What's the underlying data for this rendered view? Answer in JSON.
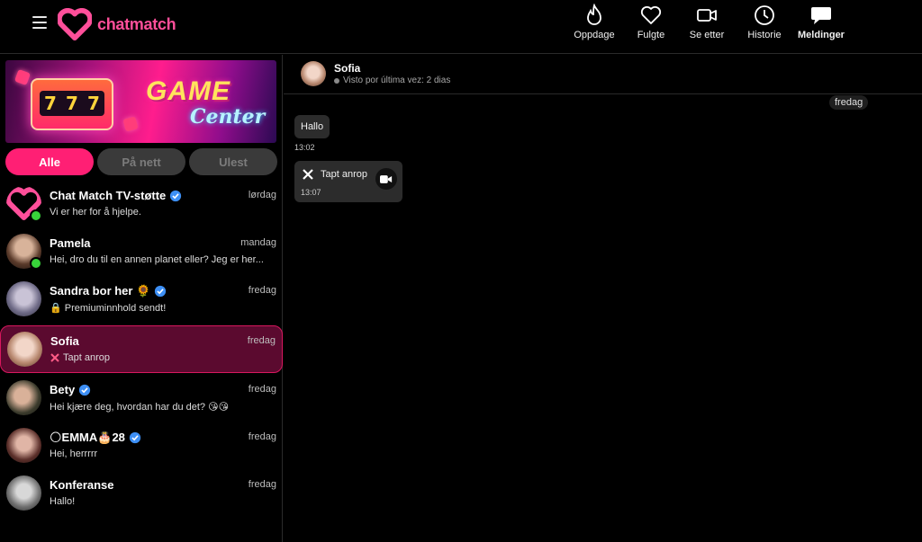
{
  "app": {
    "brand": "chatmatch",
    "brand_color": "#ff4f9a"
  },
  "nav": {
    "items": [
      {
        "label": "Oppdage",
        "icon": "flame-icon"
      },
      {
        "label": "Fulgte",
        "icon": "heart-icon"
      },
      {
        "label": "Se etter",
        "icon": "video-camera-icon"
      },
      {
        "label": "Historie",
        "icon": "clock-icon"
      },
      {
        "label": "Meldinger",
        "icon": "chat-bubble-icon",
        "active": true
      }
    ]
  },
  "banner": {
    "title": "GAME",
    "subtitle": "Center",
    "slot_digits": [
      "7",
      "7",
      "7"
    ]
  },
  "filters": {
    "items": [
      "Alle",
      "På nett",
      "Ulest"
    ],
    "active": "Alle",
    "active_color": "#ff1f74"
  },
  "conversations": [
    {
      "name": "Chat Match TV-støtte",
      "day": "lørdag",
      "preview": "Vi er her for å hjelpe.",
      "verified": true,
      "online": true
    },
    {
      "name": "Pamela",
      "day": "mandag",
      "preview": "Hei, dro du til en annen planet eller? Jeg er her...",
      "verified": false,
      "online": true
    },
    {
      "name": "Sandra bor her 🌻",
      "day": "fredag",
      "preview": "🔒 Premiuminnhold sendt!",
      "verified": true,
      "online": false
    },
    {
      "name": "Sofia",
      "day": "fredag",
      "preview": "Tapt anrop",
      "verified": false,
      "online": false,
      "active": true
    },
    {
      "name": "Bety",
      "day": "fredag",
      "preview": "Hei kjære deg, hvordan har du det? 😘😘",
      "verified": true,
      "online": false
    },
    {
      "name": "🌕EMMA🎂28",
      "day": "fredag",
      "preview": "Hei, herrrrr",
      "verified": true,
      "online": false
    },
    {
      "name": "Konferanse",
      "day": "fredag",
      "preview": "Hallo!",
      "verified": false,
      "online": false
    }
  ],
  "chat": {
    "name": "Sofia",
    "status": "Visto por última vez: 2 dias",
    "date_chip": "fredag",
    "messages": [
      {
        "text": "Hallo",
        "time": "13:02"
      },
      {
        "text": "Tapt anrop",
        "time": "13:07",
        "type": "missed-call"
      }
    ]
  }
}
